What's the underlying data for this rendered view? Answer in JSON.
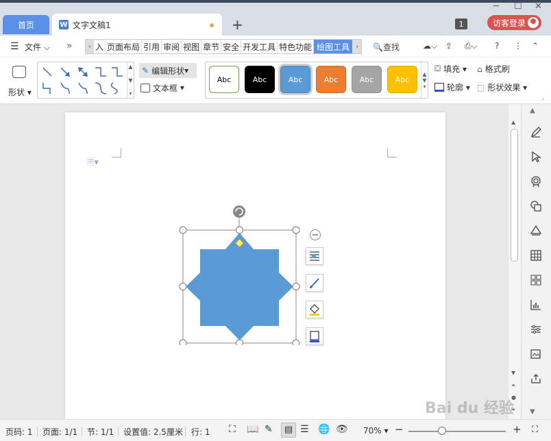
{
  "tabs": {
    "home_label": "首页",
    "doc_label": "文字文稿1",
    "doc_icon_letter": "W",
    "add_label": "+"
  },
  "window": {
    "notif_count": "1",
    "login_label": "访客登录"
  },
  "menubar": {
    "file_label": "文件",
    "ribbon_tabs": [
      "入",
      "页面布局",
      "引用",
      "审阅",
      "视图",
      "章节",
      "安全",
      "开发工具",
      "特色功能",
      "绘图工具"
    ],
    "active_tab": "绘图工具",
    "search_label": "查找"
  },
  "ribbon": {
    "shape_label": "形状",
    "edit_shape_label": "编辑形状",
    "textbox_label": "文本框",
    "styles": [
      {
        "label": "Abc",
        "bg": "#ffffff",
        "fg": "#000000",
        "border": "#6aa84f"
      },
      {
        "label": "Abc",
        "bg": "#000000",
        "fg": "#ffffff",
        "border": "#000000"
      },
      {
        "label": "Abc",
        "bg": "#5b9bd5",
        "fg": "#ffffff",
        "border": "#4a86c0"
      },
      {
        "label": "Abc",
        "bg": "#ed7d31",
        "fg": "#ffffff",
        "border": "#d06a25"
      },
      {
        "label": "Abc",
        "bg": "#a5a5a5",
        "fg": "#ffffff",
        "border": "#8f8f8f"
      },
      {
        "label": "Abc",
        "bg": "#ffc000",
        "fg": "#ffffff",
        "border": "#e0a800"
      }
    ],
    "fill_label": "填充",
    "format_painter_label": "格式刷",
    "outline_label": "轮廓",
    "shape_effect_label": "形状效果"
  },
  "shape": {
    "type": "8-point-star",
    "fill_color": "#5b9bd5"
  },
  "statusbar": {
    "page_num": "页码: 1",
    "pages": "页面: 1/1",
    "section": "节: 1/1",
    "setting": "设置值: 2.5厘米",
    "row": "行: 1",
    "zoom": "70%",
    "zoom_percent": 70
  },
  "watermark": "Bai du 经验"
}
